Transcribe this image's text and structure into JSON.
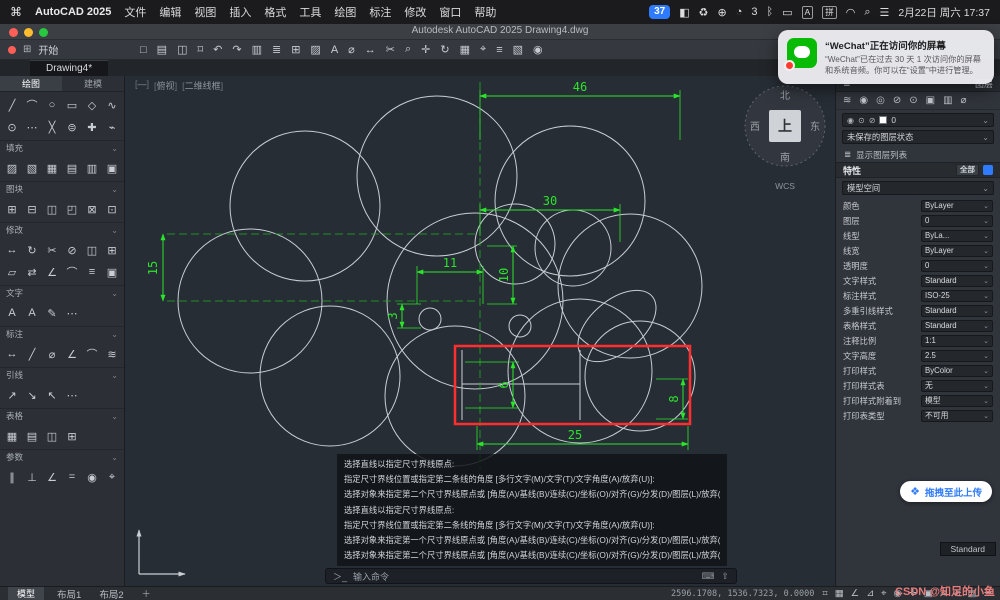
{
  "ui": {
    "chevron": "⌄",
    "caret": "▾",
    "list_arrow": "≣"
  },
  "menubar": {
    "apple_logo": "⌘",
    "app_name": "AutoCAD 2025",
    "menus": [
      "文件",
      "编辑",
      "视图",
      "插入",
      "格式",
      "工具",
      "绘图",
      "标注",
      "修改",
      "窗口",
      "帮助"
    ],
    "screen_badge": "37",
    "status_icons_a": [
      {
        "name": "display-mirroring-icon",
        "glyph": "◧"
      },
      {
        "name": "recycle-icon",
        "glyph": "♻"
      },
      {
        "name": "sync-icon",
        "glyph": "⊕"
      },
      {
        "name": "notification-bell-icon",
        "glyph": "◔"
      },
      {
        "name": "notification-count",
        "glyph": "3"
      },
      {
        "name": "bluetooth-icon",
        "glyph": "ᛒ"
      },
      {
        "name": "battery-icon",
        "glyph": "▭"
      }
    ],
    "input_sources": [
      {
        "name": "input-source-abc",
        "label": "A"
      },
      {
        "name": "input-source-pinyin",
        "label": "拼"
      }
    ],
    "status_icons_b": [
      {
        "name": "wifi-icon",
        "glyph": "◠"
      },
      {
        "name": "search-icon",
        "glyph": "⌕"
      },
      {
        "name": "control-center-icon",
        "glyph": "☰"
      }
    ],
    "datetime": "2月22日 周六 17:37"
  },
  "titlebar": {
    "title": "Autodesk AutoCAD 2025   Drawing4.dwg"
  },
  "toolbar": {
    "grid_glyph": "⊞",
    "start_tab": "开始",
    "icons": [
      {
        "name": "new-file-icon",
        "glyph": "□"
      },
      {
        "name": "open-file-icon",
        "glyph": "▤"
      },
      {
        "name": "save-icon",
        "glyph": "◫"
      },
      {
        "name": "print-icon",
        "glyph": "⌑"
      },
      {
        "name": "undo-icon",
        "glyph": "↶"
      },
      {
        "name": "redo-icon",
        "glyph": "↷"
      },
      {
        "name": "plot-icon",
        "glyph": "▥"
      },
      {
        "name": "layers-icon",
        "glyph": "≣"
      },
      {
        "name": "block-icon",
        "glyph": "⊞"
      },
      {
        "name": "hatch-icon",
        "glyph": "▨"
      },
      {
        "name": "text-tool-icon",
        "glyph": "A"
      },
      {
        "name": "measure-icon",
        "glyph": "⌀"
      },
      {
        "name": "dimension-icon",
        "glyph": "↔"
      },
      {
        "name": "trim-icon",
        "glyph": "✂"
      },
      {
        "name": "zoom-icon",
        "glyph": "⌕"
      },
      {
        "name": "pan-icon",
        "glyph": "✛"
      },
      {
        "name": "orbit-icon",
        "glyph": "↻"
      },
      {
        "name": "grid-icon",
        "glyph": "▦"
      },
      {
        "name": "osnap-icon",
        "glyph": "⌖"
      },
      {
        "name": "properties-icon",
        "glyph": "≡"
      },
      {
        "name": "group-icon",
        "glyph": "▧"
      },
      {
        "name": "view-icon",
        "glyph": "◉"
      }
    ]
  },
  "tabs": {
    "doc_tab": "Drawing4*"
  },
  "notification": {
    "title": "“WeChat”正在访问你的屏幕",
    "body": "“WeChat”已在过去 30 天 1 次访问你的屏幕和系统音频。你可以在“设置”中进行管理。"
  },
  "palette": {
    "tabs": [
      {
        "name": "palette-tab-draw",
        "label": "绘图",
        "active": "1"
      },
      {
        "name": "palette-tab-model",
        "label": "建模",
        "active": ""
      }
    ],
    "draw_icons": [
      {
        "name": "line-icon",
        "glyph": "╱"
      },
      {
        "name": "arc-icon",
        "glyph": "⌒"
      },
      {
        "name": "circle-icon",
        "glyph": "○"
      },
      {
        "name": "rectangle-icon",
        "glyph": "▭"
      },
      {
        "name": "polygon-icon",
        "glyph": "◇"
      },
      {
        "name": "spline-icon",
        "glyph": "∿"
      },
      {
        "name": "donut-icon",
        "glyph": "⊙"
      },
      {
        "name": "point-icon",
        "glyph": "⋯"
      },
      {
        "name": "xline-icon",
        "glyph": "╳"
      },
      {
        "name": "ellipse-icon",
        "glyph": "⊜"
      },
      {
        "name": "centerline-icon",
        "glyph": "✚"
      },
      {
        "name": "ray-icon",
        "glyph": "⌁"
      }
    ],
    "sections": [
      {
        "label": "填充",
        "icons": [
          {
            "name": "hatch-pattern-icon",
            "glyph": "▨"
          },
          {
            "name": "hatch-gradient-icon",
            "glyph": "▧"
          },
          {
            "name": "hatch-solid-icon",
            "glyph": "▦"
          },
          {
            "name": "hatch-user-icon",
            "glyph": "▤"
          },
          {
            "name": "hatch-boundary-icon",
            "glyph": "▥"
          },
          {
            "name": "hatch-edit-icon",
            "glyph": "▣"
          }
        ]
      },
      {
        "label": "图块",
        "icons": [
          {
            "name": "insert-block-icon",
            "glyph": "⊞"
          },
          {
            "name": "create-block-icon",
            "glyph": "⊟"
          },
          {
            "name": "block-editor-icon",
            "glyph": "◫"
          },
          {
            "name": "attribute-icon",
            "glyph": "◰"
          },
          {
            "name": "wblock-icon",
            "glyph": "⊠"
          },
          {
            "name": "block-palette-icon",
            "glyph": "⊡"
          }
        ]
      },
      {
        "label": "修改",
        "icons": [
          {
            "name": "move-icon",
            "glyph": "↔"
          },
          {
            "name": "rotate-icon",
            "glyph": "↻"
          },
          {
            "name": "trim-icon",
            "glyph": "✂"
          },
          {
            "name": "erase-icon",
            "glyph": "⊘"
          },
          {
            "name": "copy-icon",
            "glyph": "◫"
          },
          {
            "name": "array-icon",
            "glyph": "⊞"
          },
          {
            "name": "mirror-icon",
            "glyph": "▱"
          },
          {
            "name": "offset-icon",
            "glyph": "⇄"
          },
          {
            "name": "chamfer-icon",
            "glyph": "∠"
          },
          {
            "name": "fillet-icon",
            "glyph": "⌒"
          },
          {
            "name": "stretch-icon",
            "glyph": "≡"
          },
          {
            "name": "scale-icon",
            "glyph": "▣"
          }
        ]
      },
      {
        "label": "文字",
        "icons": [
          {
            "name": "mtext-icon",
            "glyph": "A"
          },
          {
            "name": "single-text-icon",
            "glyph": "A"
          },
          {
            "name": "edit-text-icon",
            "glyph": "✎"
          },
          {
            "name": "text-more-icon",
            "glyph": "⋯"
          }
        ]
      },
      {
        "label": "标注",
        "icons": [
          {
            "name": "linear-dim-icon",
            "glyph": "↔"
          },
          {
            "name": "aligned-dim-icon",
            "glyph": "╱"
          },
          {
            "name": "diameter-dim-icon",
            "glyph": "⌀"
          },
          {
            "name": "angular-dim-icon",
            "glyph": "∠"
          },
          {
            "name": "arc-dim-icon",
            "glyph": "⌒"
          },
          {
            "name": "ordinate-dim-icon",
            "glyph": "≋"
          }
        ]
      },
      {
        "label": "引线",
        "icons": [
          {
            "name": "mleader-icon",
            "glyph": "↗"
          },
          {
            "name": "leader-align-icon",
            "glyph": "↘"
          },
          {
            "name": "leader-collect-icon",
            "glyph": "↖"
          },
          {
            "name": "leader-more-icon",
            "glyph": "⋯"
          }
        ]
      },
      {
        "label": "表格",
        "icons": [
          {
            "name": "table-icon",
            "glyph": "▦"
          },
          {
            "name": "table-style-icon",
            "glyph": "▤"
          },
          {
            "name": "table-cell-icon",
            "glyph": "◫"
          },
          {
            "name": "table-insert-icon",
            "glyph": "⊞"
          }
        ]
      },
      {
        "label": "参数",
        "icons": [
          {
            "name": "parallel-constraint-icon",
            "glyph": "∥"
          },
          {
            "name": "perpendicular-constraint-icon",
            "glyph": "⊥"
          },
          {
            "name": "angular-constraint-icon",
            "glyph": "∠"
          },
          {
            "name": "equal-constraint-icon",
            "glyph": "="
          },
          {
            "name": "concentric-constraint-icon",
            "glyph": "◉"
          },
          {
            "name": "fix-constraint-icon",
            "glyph": "⌖"
          }
        ]
      }
    ]
  },
  "canvas": {
    "viewport_controls": [
      "—",
      "俯视",
      "二维线框"
    ],
    "viewcube": {
      "north": "北",
      "south": "南",
      "west": "西",
      "east": "东",
      "top": "上",
      "wcs": "WCS"
    },
    "dimensions": {
      "d46": "46",
      "d30": "30",
      "d11": "11",
      "d10": "10",
      "d15": "15",
      "d3": "3",
      "d6": "6",
      "d8": "8",
      "d25": "25"
    }
  },
  "command": {
    "lines": [
      "选择直线以指定尺寸界线原点:",
      "指定尺寸界线位置或指定第二条线的角度 [多行文字(M)/文字(T)/文字角度(A)/放弃(U)]:",
      "选择对象来指定第二个尺寸界线原点或 [角度(A)/基线(B)/连续(C)/坐标(O)/对齐(G)/分发(D)/图层(L)/放弃(U)]:",
      "选择直线以指定尺寸界线原点:",
      "指定尺寸界线位置或指定第二条线的角度 [多行文字(M)/文字(T)/文字角度(A)/放弃(U)]:",
      "选择对象来指定第一个尺寸界线原点或 [角度(A)/基线(B)/连续(C)/坐标(O)/对齐(G)/分发(D)/图层(L)/放弃(U)]:",
      "选择对象来指定第二个尺寸界线原点或 [角度(A)/基线(B)/连续(C)/坐标(O)/对齐(G)/分发(D)/图层(L)/放弃(U)]:"
    ],
    "prompt": "＞_",
    "placeholder": "输入命令",
    "keyboard_glyph": "⌨",
    "expand_glyph": "⇧"
  },
  "properties_panel": {
    "menu_glyph": "≣",
    "layers_header": "图层",
    "layer_tool_icons": [
      {
        "name": "layer-new-icon",
        "glyph": "≋"
      },
      {
        "name": "layer-on-icon",
        "glyph": "◉"
      },
      {
        "name": "layer-off-icon",
        "glyph": "◎"
      },
      {
        "name": "layer-lock-icon",
        "glyph": "⊘"
      },
      {
        "name": "layer-freeze-icon",
        "glyph": "⊙"
      },
      {
        "name": "layer-color-icon",
        "glyph": "▣"
      },
      {
        "name": "layer-match-icon",
        "glyph": "▥"
      },
      {
        "name": "layer-isolate-icon",
        "glyph": "⌀"
      }
    ],
    "layer_row_icons": [
      {
        "name": "layer-visibility-icon",
        "glyph": "◉"
      },
      {
        "name": "layer-sun-icon",
        "glyph": "⊙"
      },
      {
        "name": "layer-unlock-icon",
        "glyph": "⊘"
      }
    ],
    "layer_value": "0",
    "layer_state_value": "未保存的图层状态",
    "show_layer_list": "显示图层列表",
    "properties_header": "特性",
    "all_button": "全部",
    "space_value": "模型空间",
    "rows": [
      {
        "label": "颜色",
        "value": "ByLayer"
      },
      {
        "label": "图层",
        "value": "0"
      },
      {
        "label": "线型",
        "value": "ByLa..."
      },
      {
        "label": "线宽",
        "value": "ByLayer"
      },
      {
        "label": "透明度",
        "value": "0"
      },
      {
        "label": "文字样式",
        "value": "Standard"
      },
      {
        "label": "标注样式",
        "value": "ISO-25"
      },
      {
        "label": "多重引线样式",
        "value": "Standard"
      },
      {
        "label": "表格样式",
        "value": "Standard"
      },
      {
        "label": "注释比例",
        "value": "1:1"
      },
      {
        "label": "文字高度",
        "value": "2.5"
      },
      {
        "label": "打印样式",
        "value": "ByColor"
      },
      {
        "label": "打印样式表",
        "value": "无"
      },
      {
        "label": "打印样式附着到",
        "value": "模型"
      },
      {
        "label": "打印表类型",
        "value": "不可用"
      }
    ],
    "upload_icon": "❖",
    "upload_label": "拖拽至此上传",
    "standard_label": "Standard"
  },
  "statusbar": {
    "model_tab": "模型",
    "layout_tabs": [
      "布局1",
      "布局2"
    ],
    "add_layout": "＋",
    "coordinates": "2596.1708, 1536.7323, 0.0000",
    "icons": [
      {
        "name": "grid-display-icon",
        "glyph": "⌗"
      },
      {
        "name": "snap-mode-icon",
        "glyph": "▦"
      },
      {
        "name": "ortho-mode-icon",
        "glyph": "∠"
      },
      {
        "name": "polar-tracking-icon",
        "glyph": "⊿"
      },
      {
        "name": "osnap-icon",
        "glyph": "⌖"
      },
      {
        "name": "object-track-icon",
        "glyph": "◉"
      },
      {
        "name": "dynamic-input-icon",
        "glyph": "✛"
      },
      {
        "name": "lineweight-icon",
        "glyph": "▣"
      },
      {
        "name": "transparency-icon",
        "glyph": "≋"
      },
      {
        "name": "annotation-scale-icon",
        "glyph": "⌀"
      },
      {
        "name": "workspace-icon",
        "glyph": "▤"
      },
      {
        "name": "customize-icon",
        "glyph": "☰"
      }
    ]
  },
  "watermark": "CSDN @知足的小鱼",
  "colors": {
    "dim_green": "#2be42b",
    "highlight_red": "#ff2f2f",
    "accent_blue": "#2f7bff",
    "wechat_green": "#09bb07"
  }
}
